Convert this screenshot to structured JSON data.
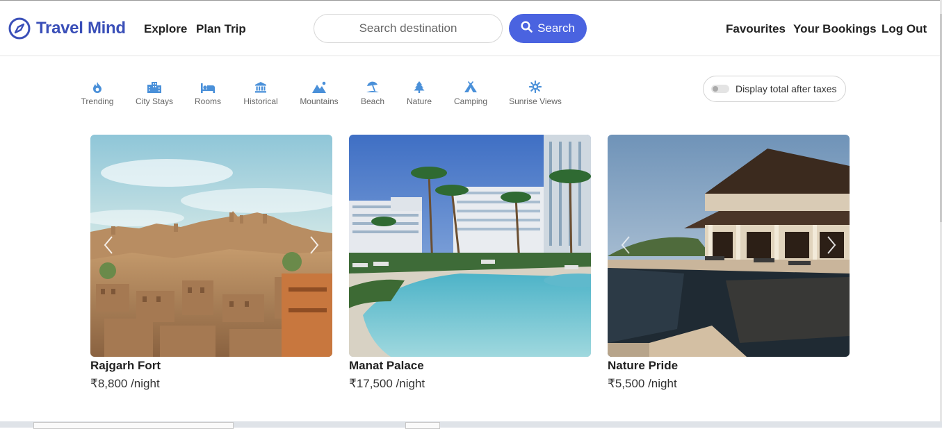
{
  "brand": {
    "name": "Travel Mind",
    "accent": "#3a4fb8",
    "button_color": "#4a63e0"
  },
  "nav": {
    "explore": "Explore",
    "plan_trip": "Plan Trip"
  },
  "search": {
    "placeholder": "Search destination",
    "button_label": "Search"
  },
  "user_menu": {
    "favourites": "Favourites",
    "bookings": "Your Bookings",
    "logout": "Log Out"
  },
  "filters": [
    {
      "label": "Trending",
      "icon": "fire-icon"
    },
    {
      "label": "City Stays",
      "icon": "city-icon"
    },
    {
      "label": "Rooms",
      "icon": "bed-icon"
    },
    {
      "label": "Historical",
      "icon": "monument-icon"
    },
    {
      "label": "Mountains",
      "icon": "mountain-icon"
    },
    {
      "label": "Beach",
      "icon": "umbrella-beach-icon"
    },
    {
      "label": "Nature",
      "icon": "tree-icon"
    },
    {
      "label": "Camping",
      "icon": "campground-icon"
    },
    {
      "label": "Sunrise Views",
      "icon": "sun-icon"
    }
  ],
  "filter_icon_color": "#4a90d9",
  "tax_toggle": {
    "label": "Display total after taxes",
    "enabled": false
  },
  "listings": [
    {
      "title": "Rajgarh Fort",
      "price": "₹8,800 /night"
    },
    {
      "title": "Manat Palace",
      "price": "₹17,500 /night"
    },
    {
      "title": "Nature Pride",
      "price": "₹5,500 /night"
    }
  ]
}
